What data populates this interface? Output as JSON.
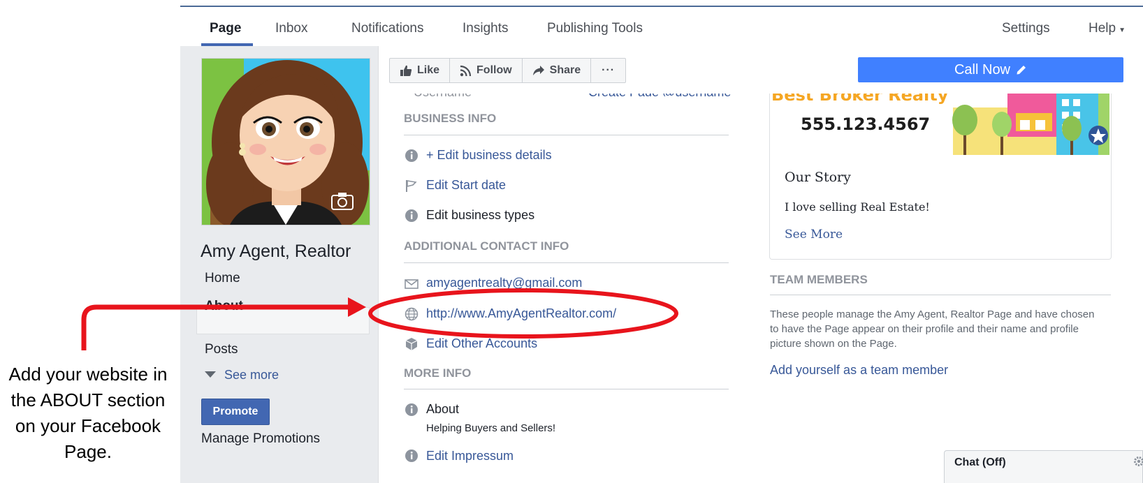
{
  "nav": {
    "tabs": [
      {
        "label": "Page"
      },
      {
        "label": "Inbox"
      },
      {
        "label": "Notifications"
      },
      {
        "label": "Insights"
      },
      {
        "label": "Publishing Tools"
      }
    ],
    "settings_label": "Settings",
    "help_label": "Help"
  },
  "profile": {
    "page_name": "Amy Agent, Realtor"
  },
  "sidebar": {
    "items": [
      {
        "label": "Home"
      },
      {
        "label": "About"
      },
      {
        "label": "Posts"
      }
    ],
    "see_more_label": "See more",
    "promote_label": "Promote",
    "manage_promotions_label": "Manage Promotions"
  },
  "actions": {
    "like_label": "Like",
    "follow_label": "Follow",
    "share_label": "Share",
    "more_label": "···",
    "call_now_label": "Call Now"
  },
  "about": {
    "username_label": "Username",
    "username_link": "Create Page @username",
    "business_info": {
      "heading": "BUSINESS INFO",
      "edit_details": "+ Edit business details",
      "edit_start_date": "Edit Start date",
      "edit_types": "Edit business types"
    },
    "contact_info": {
      "heading": "ADDITIONAL CONTACT INFO",
      "email": "amyagentrealty@gmail.com",
      "website": "http://www.AmyAgentRealtor.com/",
      "edit_other_accounts": "Edit Other Accounts"
    },
    "more_info": {
      "heading": "MORE INFO",
      "about_label": "About",
      "about_text": "Helping Buyers and Sellers!",
      "edit_impressum": "Edit Impressum"
    }
  },
  "story": {
    "cover_brand": "Best Broker Realty",
    "cover_phone": "555.123.4567",
    "title": "Our Story",
    "text": "I love selling Real Estate!",
    "see_more_label": "See More"
  },
  "team": {
    "heading": "TEAM MEMBERS",
    "description": "These people manage the Amy Agent, Realtor Page and have chosen to have the Page appear on their profile and their name and profile picture shown on the Page.",
    "add_label": "Add yourself as a team member"
  },
  "chat": {
    "label": "Chat (Off)"
  },
  "annotation": {
    "text": "Add your website in the ABOUT section on your Facebook Page."
  },
  "colors": {
    "fb_blue": "#4267b2",
    "link_blue": "#385898",
    "call_now_blue": "#4080ff",
    "annotation_red": "#e8141c"
  }
}
